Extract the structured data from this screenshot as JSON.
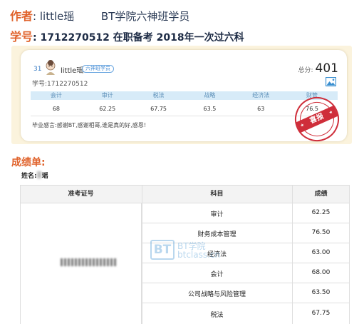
{
  "header": {
    "author_key": "作者",
    "author_sep": ":",
    "author_name": "little瑶",
    "author_desc": "BT学院六神班学员",
    "id_key": "学号",
    "id_sep": ":",
    "id_value": "1712270512 在职备考 2018年一次过六科"
  },
  "score_card": {
    "rank": "31",
    "username": "little瑶",
    "badge": "六神班学员",
    "student_id_label": "学号:",
    "student_id": "1712270512",
    "total_label": "总分:",
    "total": "401",
    "columns": [
      "会计",
      "审计",
      "税法",
      "战略",
      "经济法",
      "财管"
    ],
    "scores": [
      "68",
      "62.25",
      "67.75",
      "63.5",
      "63",
      "76.5"
    ],
    "message": "毕业感言:感谢BT,感谢相哥,谁是真的好,感恩!",
    "stamp_text": "喜报",
    "colors": {
      "card_bg": "#fbf3dd",
      "header_row": "#d7ebf8",
      "stamp": "#cf2e3a"
    }
  },
  "report": {
    "title": "成绩单:",
    "name_label": "姓名:",
    "name_value": "瑶",
    "table_headers": [
      "准考证号",
      "科目",
      "成绩"
    ],
    "rows": [
      {
        "subject": "审计",
        "score": "62.25"
      },
      {
        "subject": "财务成本管理",
        "score": "76.50"
      },
      {
        "subject": "经济法",
        "score": "63.00"
      },
      {
        "subject": "会计",
        "score": "68.00"
      },
      {
        "subject": "公司战略与风险管理",
        "score": "63.50"
      },
      {
        "subject": "税法",
        "score": "67.75"
      }
    ]
  },
  "watermark": {
    "mark": "BT",
    "line1": "BT学院",
    "line2": "btclass.cn"
  },
  "colors": {
    "accent": "#e0632c",
    "link_blue": "#3d7fc7"
  }
}
